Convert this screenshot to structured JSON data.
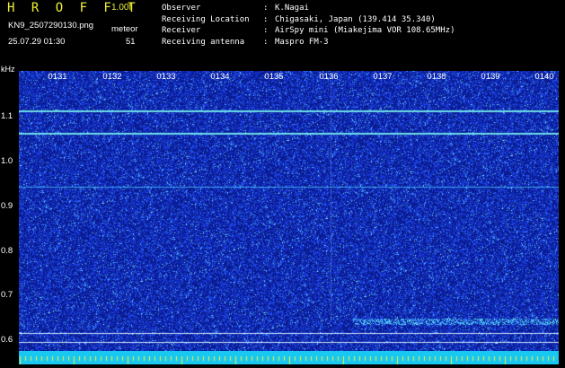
{
  "header": {
    "app_title": "H R O F F T",
    "version": "1.00f",
    "filename": "KN9_2507290130.png",
    "datetime": "25.07.29 01:30",
    "meteor_label": "meteor",
    "meteor_count": "51",
    "info": [
      {
        "key": "Observer",
        "value": "K.Nagai"
      },
      {
        "key": "Receiving Location",
        "value": "Chigasaki, Japan (139.414 35.340)"
      },
      {
        "key": "Receiver",
        "value": "AirSpy mini (Miakejima VOR 108.65MHz)"
      },
      {
        "key": "Receiving antenna",
        "value": "Maspro FM-3"
      }
    ],
    "separator": ":"
  },
  "spectrogram": {
    "unit_label": "kHz",
    "y_labels": [
      "1.1",
      "1.0",
      "0.9",
      "0.8",
      "0.7",
      "0.6"
    ],
    "x_labels": [
      "0131",
      "0132",
      "0133",
      "0134",
      "0135",
      "0136",
      "0137",
      "0138",
      "0139",
      "0140"
    ],
    "colors": {
      "background": "#0a1a8c",
      "noise": "#2a50ff",
      "signal": "#9ef0ff",
      "accent": "#f0f038",
      "bottom_bar": "#19c8f0"
    }
  }
}
